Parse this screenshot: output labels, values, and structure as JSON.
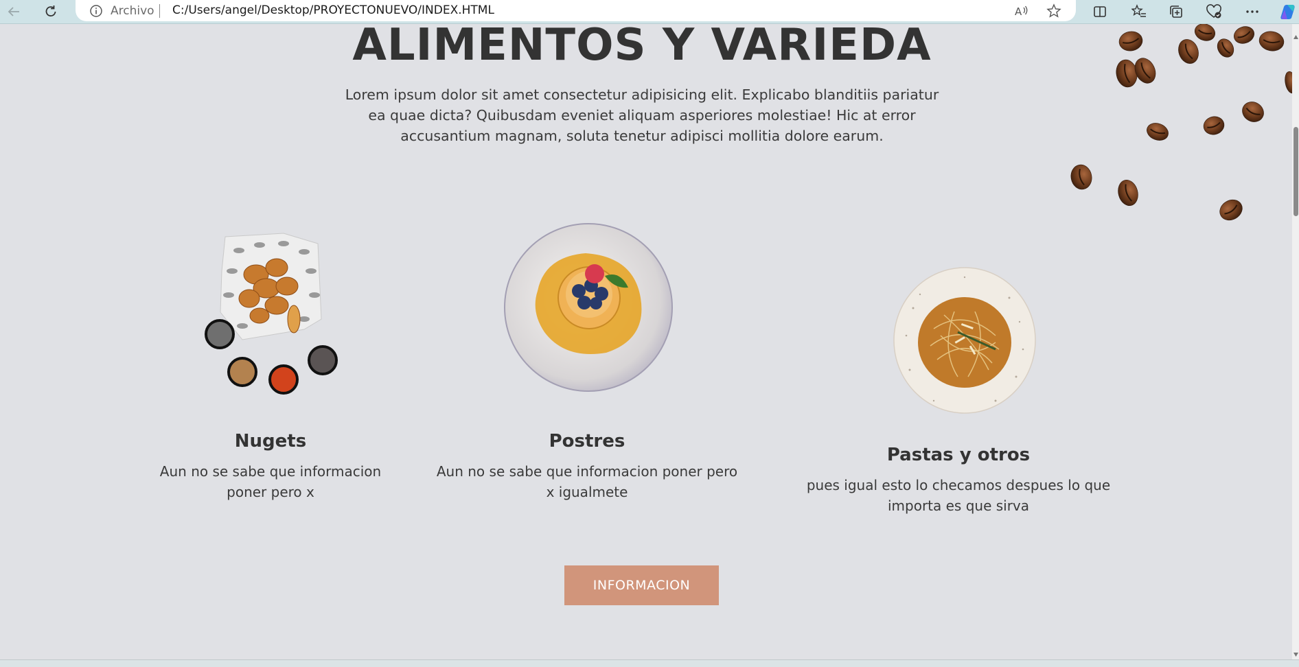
{
  "browser": {
    "address_label": "Archivo",
    "url": "C:/Users/angel/Desktop/PROYECTONUEVO/INDEX.HTML"
  },
  "hero": {
    "title": "ALIMENTOS Y VARIEDA",
    "text": "Lorem ipsum dolor sit amet consectetur adipisicing elit. Explicabo blanditiis pariatur ea quae dicta? Quibusdam eveniet aliquam asperiores molestiae! Hic at error accusantium magnam, soluta tenetur adipisci mollitia dolore earum."
  },
  "cards": [
    {
      "title": "Nugets",
      "text": "Aun no se sabe que informacion poner pero x"
    },
    {
      "title": "Postres",
      "text": "Aun no se sabe que informacion poner pero x igualmete"
    },
    {
      "title": "Pastas y otros",
      "text": "pues igual esto lo checamos despues lo que importa es que sirva"
    }
  ],
  "cta": {
    "label": "INFORMACION"
  },
  "colors": {
    "page_bg": "#e0e1e5",
    "button_bg": "#d1957b",
    "toolbar_bg": "#cfe3e7"
  }
}
